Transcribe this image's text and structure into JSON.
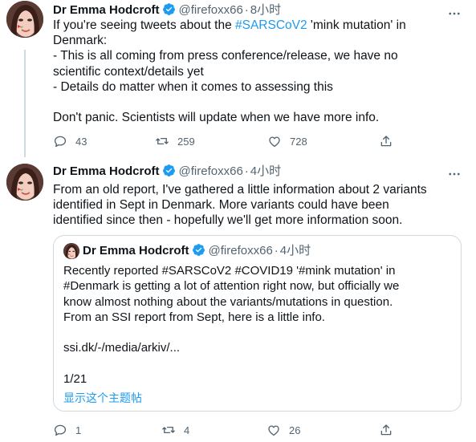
{
  "tweets": [
    {
      "author": {
        "name": "Dr Emma Hodcroft",
        "handle": "@firefoxx66",
        "avatar": "avatar"
      },
      "time": "8小时",
      "dot": "·",
      "text": {
        "line1_pre": "If you're seeing tweets about the ",
        "line1_hashtag": "#SARSCoV2",
        "line1_post": " 'mink mutation' in",
        "line2": "Denmark:",
        "line3": "- This is all coming from press conference/release, we have no",
        "line4": "scientific context/details yet",
        "line5": "- Details do matter when it comes to assessing this",
        "line7": "Don't panic. Scientists will update when we have more info."
      },
      "actions": {
        "replies": "43",
        "retweets": "259",
        "likes": "728"
      }
    },
    {
      "author": {
        "name": "Dr Emma Hodcroft",
        "handle": "@firefoxx66",
        "avatar": "avatar"
      },
      "time": "4小时",
      "dot": "·",
      "text": {
        "line1": "From an old report, I've gathered a little information about 2 variants",
        "line2": "identified in Sept in Denmark. More variants could have been",
        "line3": "identified since then - hopefully we'll get more information soon."
      },
      "quote": {
        "author": {
          "name": "Dr Emma Hodcroft",
          "handle": "@firefoxx66"
        },
        "time": "4小时",
        "dot": "·",
        "text": {
          "line1": "Recently reported #SARSCoV2 #COVID19 '#mink mutation' in",
          "line2": "#Denmark is getting a lot of attention right now, but officially we",
          "line3": "know almost nothing about the variants/mutations in question.",
          "line4": "From an SSI report from Sept, here is a little info.",
          "line6": "ssi.dk/-/media/arkiv/...",
          "line8": "1/21"
        },
        "show_thread": "显示这个主题帖"
      },
      "actions": {
        "replies": "1",
        "retweets": "4",
        "likes": "26"
      }
    }
  ],
  "colors": {
    "accent": "#1d9bf0",
    "secondary_text": "#536471",
    "border": "#cfd9de",
    "verified": "#1d9bf0"
  },
  "icons": [
    "verified-badge-icon",
    "more-icon",
    "reply-icon",
    "retweet-icon",
    "like-icon",
    "share-icon"
  ]
}
